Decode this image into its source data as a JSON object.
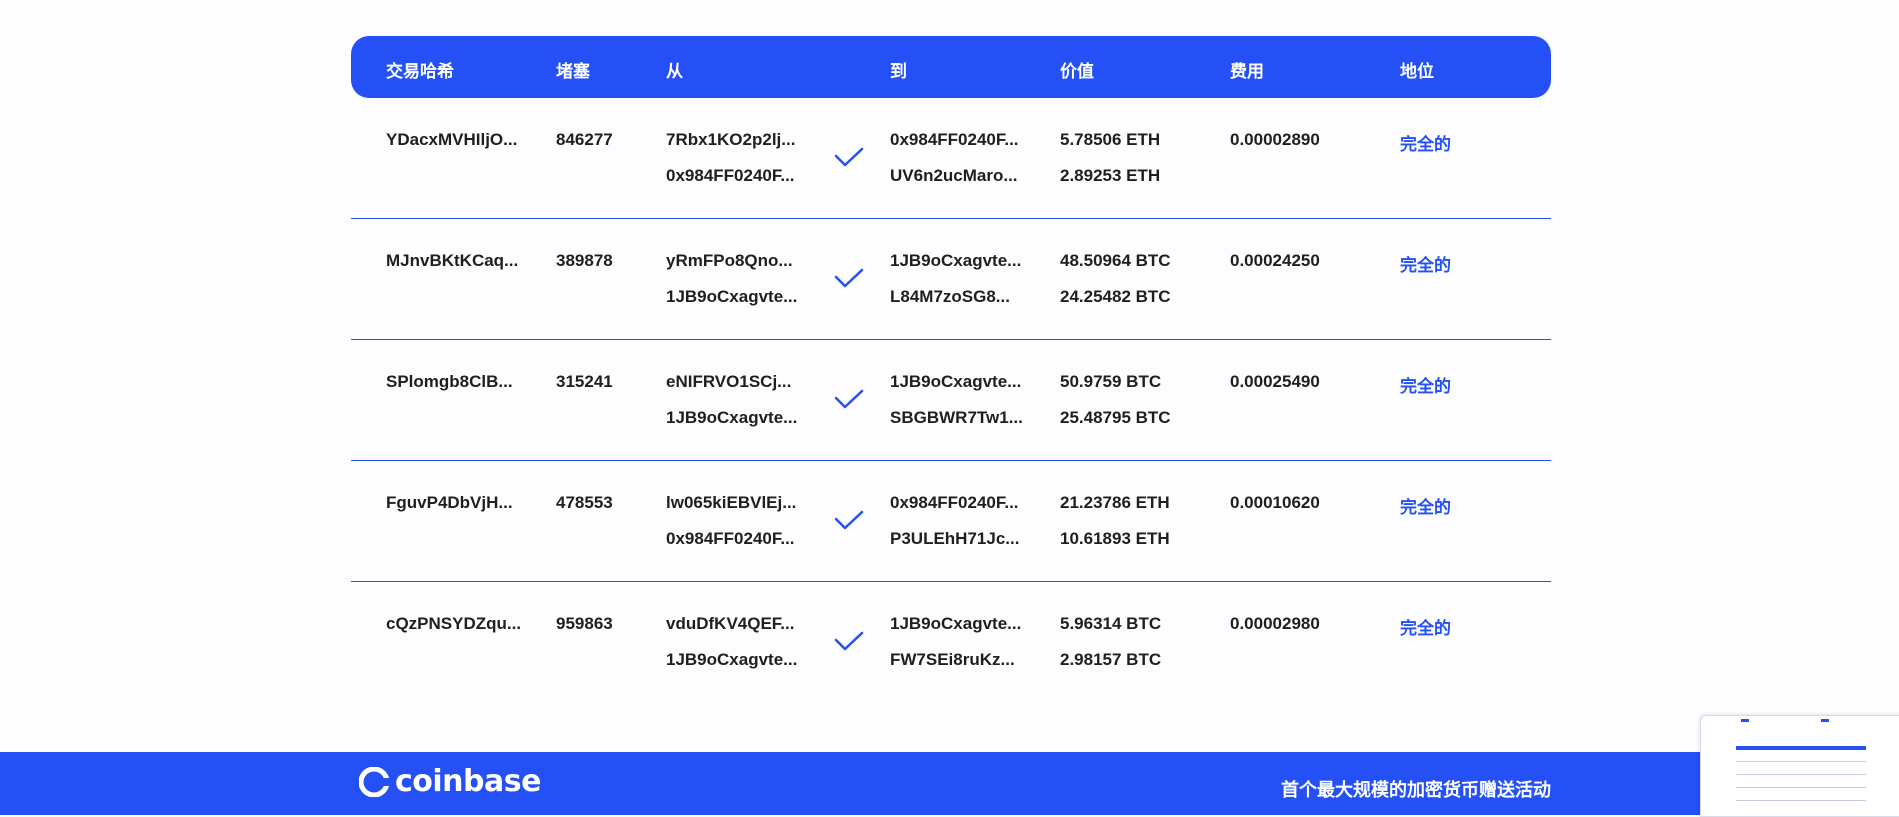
{
  "table": {
    "headers": {
      "hash": "交易哈希",
      "block": "堵塞",
      "from": "从",
      "to": "到",
      "value": "价值",
      "fee": "费用",
      "status": "地位"
    },
    "rows": [
      {
        "hash": "YDacxMVHIljO...",
        "block": "846277",
        "from1": "7Rbx1KO2p2lj...",
        "from2": "0x984FF0240F...",
        "to1": "0x984FF0240F...",
        "to2": "UV6n2ucMaro...",
        "value1": "5.78506 ETH",
        "value2": "2.89253 ETH",
        "fee": "0.00002890",
        "status": "完全的"
      },
      {
        "hash": "MJnvBKtKCaq...",
        "block": "389878",
        "from1": "yRmFPo8Qno...",
        "from2": "1JB9oCxagvte...",
        "to1": "1JB9oCxagvte...",
        "to2": "L84M7zoSG8...",
        "value1": "48.50964 BTC",
        "value2": "24.25482 BTC",
        "fee": "0.00024250",
        "status": "完全的"
      },
      {
        "hash": "SPlomgb8ClB...",
        "block": "315241",
        "from1": "eNIFRVO1SCj...",
        "from2": "1JB9oCxagvte...",
        "to1": "1JB9oCxagvte...",
        "to2": "SBGBWR7Tw1...",
        "value1": "50.9759 BTC",
        "value2": "25.48795 BTC",
        "fee": "0.00025490",
        "status": "完全的"
      },
      {
        "hash": "FguvP4DbVjH...",
        "block": "478553",
        "from1": "lw065kiEBVlEj...",
        "from2": "0x984FF0240F...",
        "to1": "0x984FF0240F...",
        "to2": "P3ULEhH71Jc...",
        "value1": "21.23786 ETH",
        "value2": "10.61893 ETH",
        "fee": "0.00010620",
        "status": "完全的"
      },
      {
        "hash": "cQzPNSYDZqu...",
        "block": "959863",
        "from1": "vduDfKV4QEF...",
        "from2": "1JB9oCxagvte...",
        "to1": "1JB9oCxagvte...",
        "to2": "FW7SEi8ruKz...",
        "value1": "5.96314 BTC",
        "value2": "2.98157 BTC",
        "fee": "0.00002980",
        "status": "完全的"
      }
    ]
  },
  "footer": {
    "logo_text": "coinbase",
    "tagline": "首个最大规模的加密货币赠送活动"
  },
  "colors": {
    "accent": "#2450f5",
    "background": "#fdfdff",
    "text": "#1f1f1f"
  },
  "icons": {
    "check": "checkmark-icon",
    "logo": "coinbase-logo-icon"
  }
}
